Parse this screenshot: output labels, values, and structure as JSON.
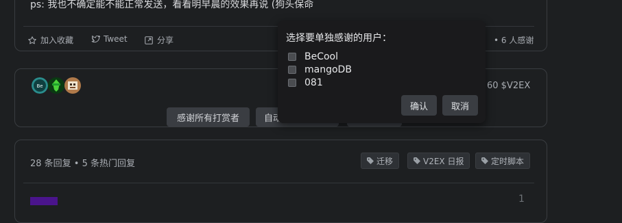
{
  "post": {
    "ps_text": "ps: 我也不确定能不能正常发送，看看明早晨的效果再说 (狗头保命",
    "actions": [
      {
        "label": "加入收藏",
        "icon": "star-icon"
      },
      {
        "label": "Tweet",
        "icon": "twitter-icon"
      },
      {
        "label": "分享",
        "icon": "share-icon"
      }
    ],
    "thanks_count": "• 6 人感谢"
  },
  "tip": {
    "avatars": [
      "BeCool",
      "mangoDB",
      "081"
    ],
    "amount": "60 $V2EX",
    "buttons": [
      "感谢所有打赏者",
      "自动",
      ""
    ]
  },
  "replies": {
    "count_text": "28 条回复 • 5 条热门回复",
    "tags": [
      "迁移",
      "V2EX 日报",
      "定时脚本"
    ],
    "reply_mark": "1"
  },
  "dialog": {
    "title": "选择要单独感谢的用户：",
    "users": [
      "BeCool",
      "mangoDB",
      "081"
    ],
    "confirm_label": "确认",
    "cancel_label": "取消"
  },
  "colors": {
    "background": "#1d1f21",
    "card_border": "#3a3d41",
    "dialog_bg": "#1a1a1c",
    "button_bg": "#3a3d42"
  }
}
